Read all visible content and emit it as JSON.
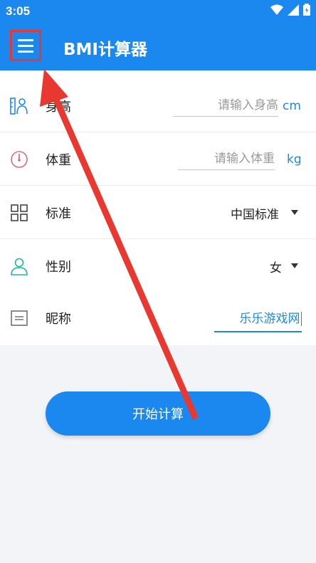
{
  "status": {
    "time": "3:05"
  },
  "header": {
    "title": "BMI计算器",
    "menu_icon": "hamburger-menu-icon"
  },
  "form": {
    "height": {
      "label": "身高",
      "placeholder": "请输入身高",
      "unit": "cm"
    },
    "weight": {
      "label": "体重",
      "placeholder": "请输入体重",
      "unit": "kg"
    },
    "standard": {
      "label": "标准",
      "value": "中国标准"
    },
    "gender": {
      "label": "性别",
      "value": "女"
    },
    "nickname": {
      "label": "昵称",
      "value": "乐乐游戏网"
    }
  },
  "action": {
    "start_label": "开始计算"
  },
  "colors": {
    "accent": "#1a88ee",
    "highlight": "#e53935"
  }
}
